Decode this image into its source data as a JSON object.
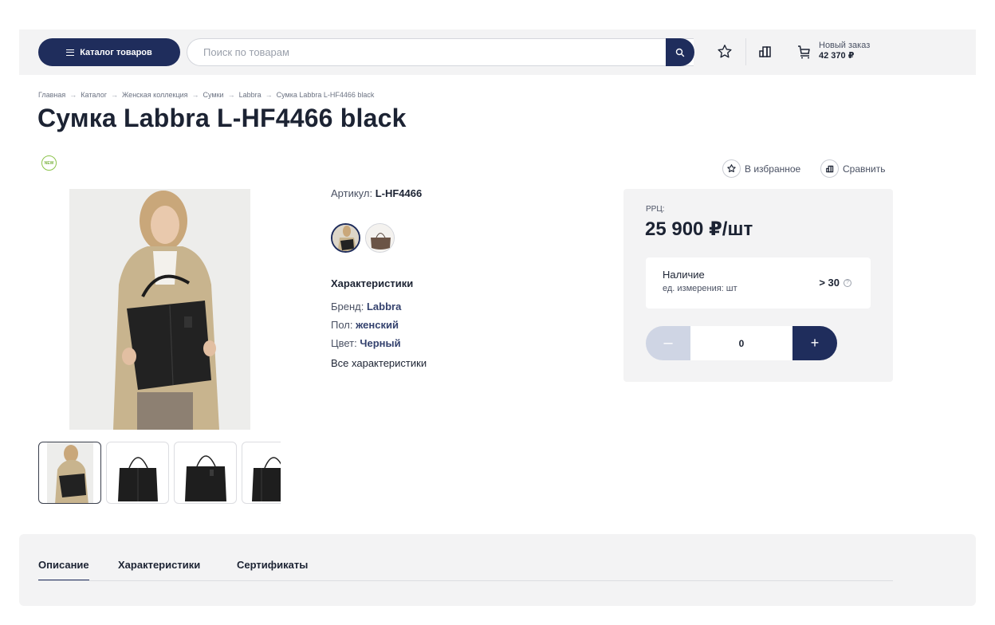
{
  "header": {
    "catalog_label": "Каталог товаров",
    "search_placeholder": "Поиск по товарам",
    "cart_title": "Новый заказ",
    "cart_total": "42 370 ₽"
  },
  "breadcrumb": [
    "Главная",
    "Каталог",
    "Женская коллекция",
    "Сумки",
    "Labbra",
    "Сумка Labbra L-HF4466 black"
  ],
  "breadcrumb_separator": "→",
  "product": {
    "title": "Сумка Labbra L-HF4466 black",
    "badge": "NEW",
    "article_label": "Артикул: ",
    "article_value": "L-HF4466",
    "characteristics_title": "Характеристики",
    "characteristics": [
      {
        "label": "Бренд: ",
        "value": "Labbra"
      },
      {
        "label": "Пол: ",
        "value": "женский"
      },
      {
        "label": "Цвет: ",
        "value": "Черный"
      }
    ],
    "all_characteristics": "Все характеристики",
    "favorite_label": "В избранное",
    "compare_label": "Сравнить"
  },
  "price_box": {
    "rrc_label": "РРЦ:",
    "price": "25 900 ₽/шт",
    "stock_label": "Наличие",
    "unit_label": "ед. измерения: шт",
    "stock_value": "> 30",
    "quantity": "0"
  },
  "tabs": [
    "Описание",
    "Характеристики",
    "Сертификаты"
  ],
  "colors": {
    "accent": "#1f2d5c",
    "new_badge": "#8bc34a",
    "panel_bg": "#f3f3f4"
  }
}
